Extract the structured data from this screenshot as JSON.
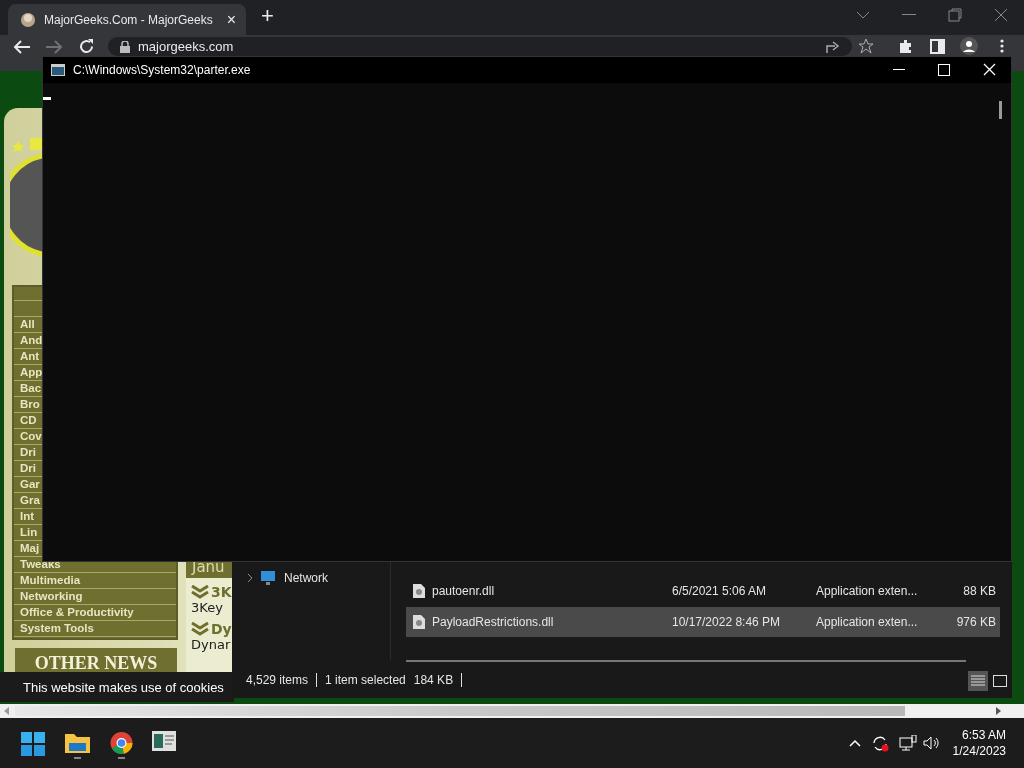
{
  "browser": {
    "tab": {
      "title": "MajorGeeks.Com - MajorGeeks",
      "close": "×"
    },
    "new_tab": "+",
    "address": "majorgeeks.com"
  },
  "website": {
    "categories": [
      "All",
      "And",
      "Ant",
      "App",
      "Bac",
      "Bro",
      "CD",
      "Cov",
      "Dri",
      "Dri",
      "Gar",
      "Gra",
      "Int",
      "Lin",
      "Maj",
      "Tweaks",
      "Multimedia",
      "Networking",
      "Office & Productivity",
      "System Tools"
    ],
    "news_month": "Janu",
    "news": [
      {
        "title": "3K",
        "text": "3Key"
      },
      {
        "title": "Dy",
        "text": "Dynar"
      }
    ],
    "other_news": "OTHER NEWS",
    "cookie_banner": "This website makes use of cookies"
  },
  "console": {
    "title": "C:\\Windows\\System32\\parter.exe"
  },
  "explorer": {
    "nav": [
      {
        "label": "Network",
        "expanded": false
      }
    ],
    "files": [
      {
        "name": "pautoenr.dll",
        "date": "6/5/2021 5:06 AM",
        "type": "Application exten...",
        "size": "88 KB",
        "selected": false
      },
      {
        "name": "PayloadRestrictions.dll",
        "date": "10/17/2022 8:46 PM",
        "type": "Application exten...",
        "size": "976 KB",
        "selected": true
      }
    ],
    "status": {
      "items": "4,529 items",
      "selection": "1 item selected",
      "size": "184 KB"
    },
    "views": [
      {
        "kind": "details",
        "selected": true
      },
      {
        "kind": "tiles",
        "selected": false
      }
    ]
  },
  "clock": {
    "time": "6:53 AM",
    "date": "1/24/2023"
  }
}
